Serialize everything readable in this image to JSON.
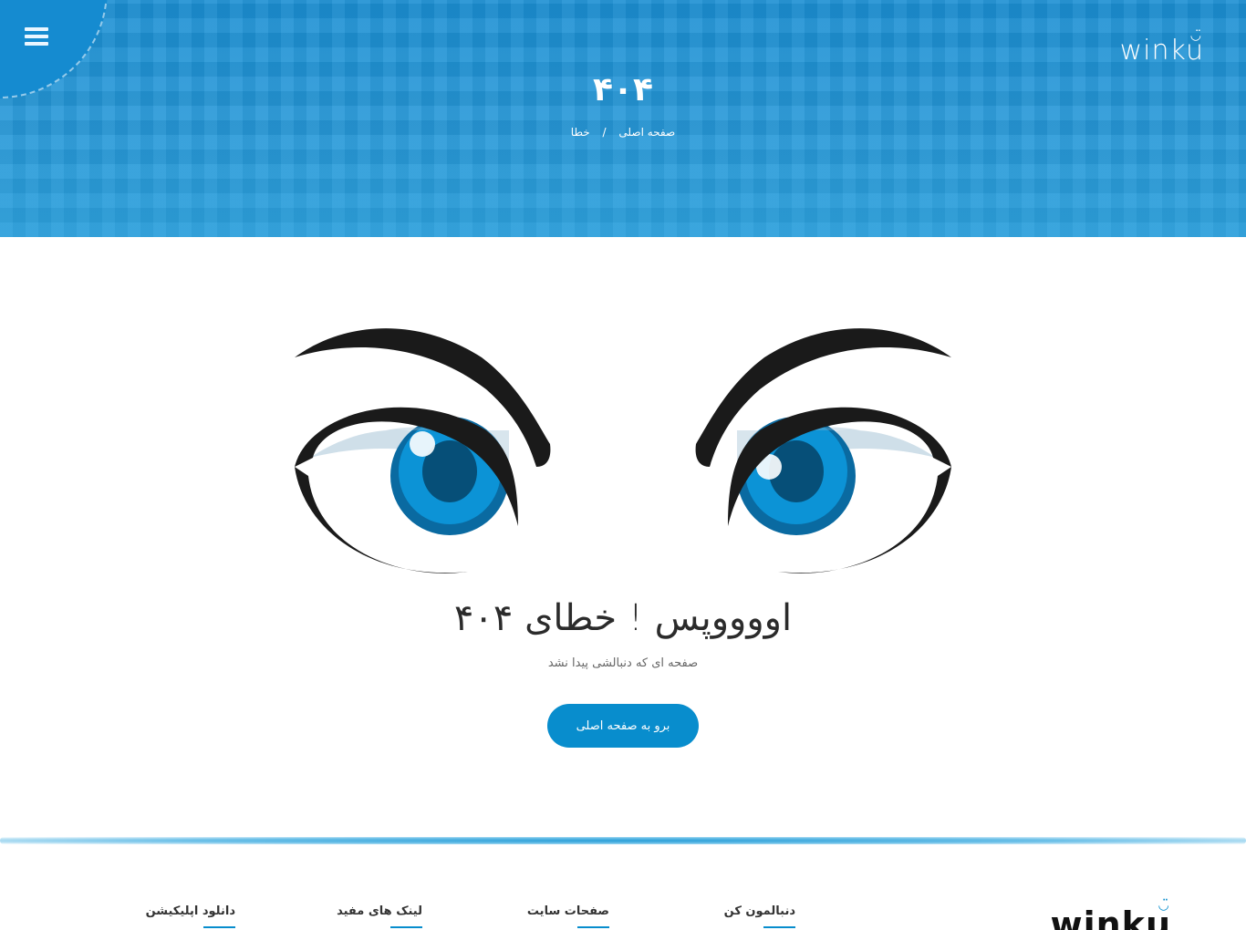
{
  "header": {
    "logo_text": "winku",
    "menu_icon": "hamburger-menu-icon",
    "title": "۴۰۴",
    "breadcrumb": {
      "home": "صفحه اصلی",
      "separator": "/",
      "current": "خطا"
    }
  },
  "illustration": {
    "icon": "angry-eyes-illustration",
    "iris_color": "#0a8fd1",
    "outline_color": "#111111"
  },
  "main": {
    "error_title": "اووووپس ! خطای ۴۰۴",
    "error_subtitle": "صفحه ای که دنبالشی پیدا نشد",
    "home_button": "برو به صفحه اصلی"
  },
  "footer": {
    "logo_text": "winku",
    "columns": [
      "دنبالمون کن",
      "صفحات سایت",
      "لینک های مفید",
      "دانلود اپلیکیشن"
    ]
  },
  "colors": {
    "brand": "#088dcd",
    "hero_bg": "#1e93d6"
  }
}
